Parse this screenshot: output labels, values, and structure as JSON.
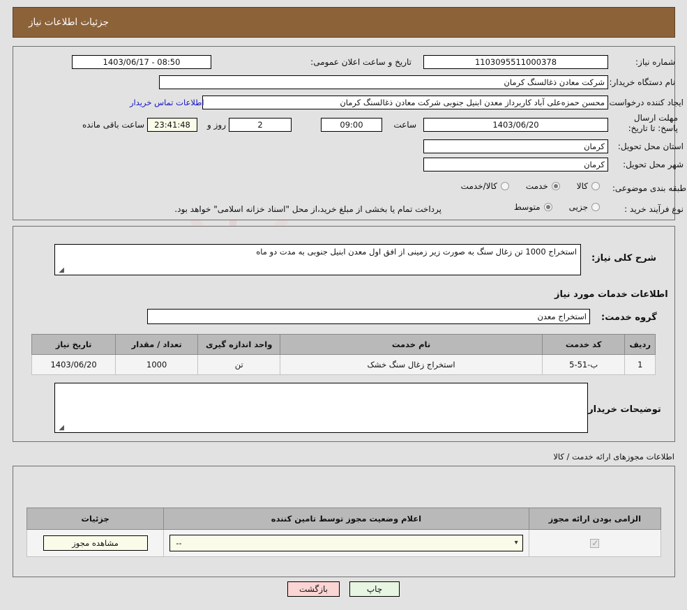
{
  "header": {
    "title": "جزئیات اطلاعات نیاز"
  },
  "watermark": {
    "text": "AnaTender.net"
  },
  "top_form": {
    "need_number_label": "شماره نیاز:",
    "need_number_value": "1103095511000378",
    "announce_label": "تاریخ و ساعت اعلان عمومی:",
    "announce_value": "08:50 - 1403/06/17",
    "buyer_org_label": "نام دستگاه خریدار:",
    "buyer_org_value": "شرکت معادن ذغالسنگ کرمان",
    "creator_label": "ایجاد کننده درخواست:",
    "creator_value": "محسن حمزه‌علی آباد کاربرداز معدن ابنیل جنوبی شرکت معادن ذغالسنگ کرمان",
    "contact_link": "اطلاعات تماس خریدار",
    "deadline_label": "مهلت ارسال پاسخ: تا تاریخ:",
    "deadline_date": "1403/06/20",
    "deadline_hour_label": "ساعت",
    "deadline_hour": "09:00",
    "days_value": "2",
    "days_label": "روز و",
    "countdown_value": "23:41:48",
    "countdown_label": "ساعت باقی مانده",
    "province_label": "استان محل تحویل:",
    "province_value": "کرمان",
    "city_label": "شهر محل تحویل:",
    "city_value": "کرمان",
    "category_label": "طبقه بندی موضوعی:",
    "category_options": [
      {
        "label": "کالا",
        "selected": false
      },
      {
        "label": "خدمت",
        "selected": true
      },
      {
        "label": "کالا/خدمت",
        "selected": false
      }
    ],
    "process_label": "نوع فرآیند خرید :",
    "process_options": [
      {
        "label": "جزیی",
        "selected": false
      },
      {
        "label": "متوسط",
        "selected": true
      }
    ],
    "process_note": "پرداخت تمام یا بخشی از مبلغ خرید،از محل \"اسناد خزانه اسلامی\" خواهد بود."
  },
  "mid": {
    "need_desc_label": "شرح کلی نیاز:",
    "need_desc_value": "استخراج 1000 تن زغال سنگ  به صورت زیر زمینی  از افق اول معدن ابنیل جنوبی به مدت دو ماه",
    "services_title": "اطلاعات خدمات مورد نیاز",
    "service_group_label": "گروه خدمت:",
    "service_group_value": "استخراج معدن",
    "table": {
      "headers": [
        "ردیف",
        "کد خدمت",
        "نام خدمت",
        "واحد اندازه گیری",
        "تعداد / مقدار",
        "تاریخ نیاز"
      ],
      "rows": [
        {
          "row": "1",
          "code": "ب-51-5",
          "name": "استخراج زغال سنگ خشک",
          "unit": "تن",
          "qty": "1000",
          "date": "1403/06/20"
        }
      ]
    },
    "buyer_comments_label": "توضیحات خریدار:",
    "buyer_comments_value": ""
  },
  "permits": {
    "section_note": "اطلاعات مجوزهای ارائه خدمت / کالا",
    "headers": [
      "الزامی بودن ارائه مجوز",
      "اعلام وضعیت مجوز توسط تامین کننده",
      "جزئیات"
    ],
    "rows": [
      {
        "required": true,
        "status_value": "--",
        "details_button": "مشاهده مجوز"
      }
    ]
  },
  "footer": {
    "back_button": "بازگشت",
    "print_button": "چاپ"
  }
}
